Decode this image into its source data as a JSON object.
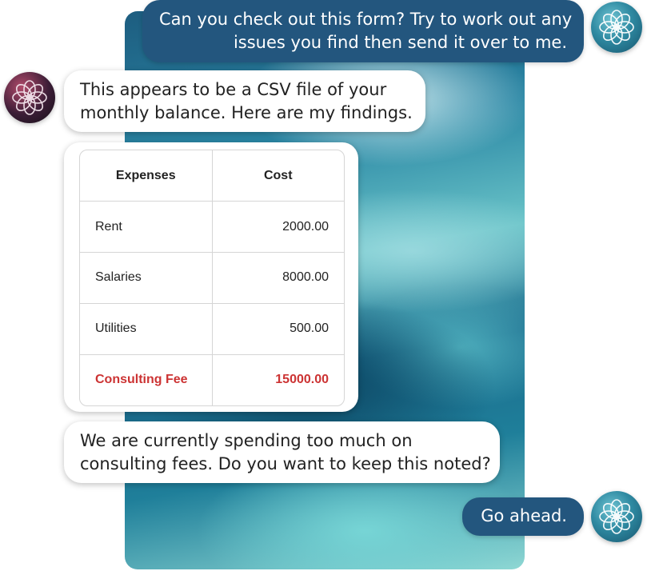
{
  "conversation": {
    "user_message_1": {
      "lines": [
        "Can you check out this form? Try to work out any",
        "issues you find then send it over to me."
      ]
    },
    "bot_message_1": {
      "lines": [
        "This appears to be a CSV file of your",
        "monthly balance. Here are my findings."
      ]
    },
    "expense_table": {
      "headers": [
        "Expenses",
        "Cost"
      ],
      "rows": [
        {
          "label": "Rent",
          "value": "2000.00"
        },
        {
          "label": "Salaries",
          "value": "8000.00"
        },
        {
          "label": "Utilities",
          "value": "500.00"
        },
        {
          "label": "Consulting Fee",
          "value": "15000.00"
        }
      ],
      "highlight_color": "#cc3333"
    },
    "bot_message_2": {
      "lines": [
        "We are currently spending too much on",
        "consulting fees. Do you want to keep this noted?"
      ]
    },
    "user_message_2": {
      "lines": [
        "Go ahead."
      ]
    }
  },
  "avatars": {
    "user": "flower-knot-icon",
    "assistant": "flower-knot-icon"
  },
  "colors": {
    "user_bubble": "#23567e",
    "bot_bubble": "#ffffff",
    "highlight": "#cc3333"
  }
}
